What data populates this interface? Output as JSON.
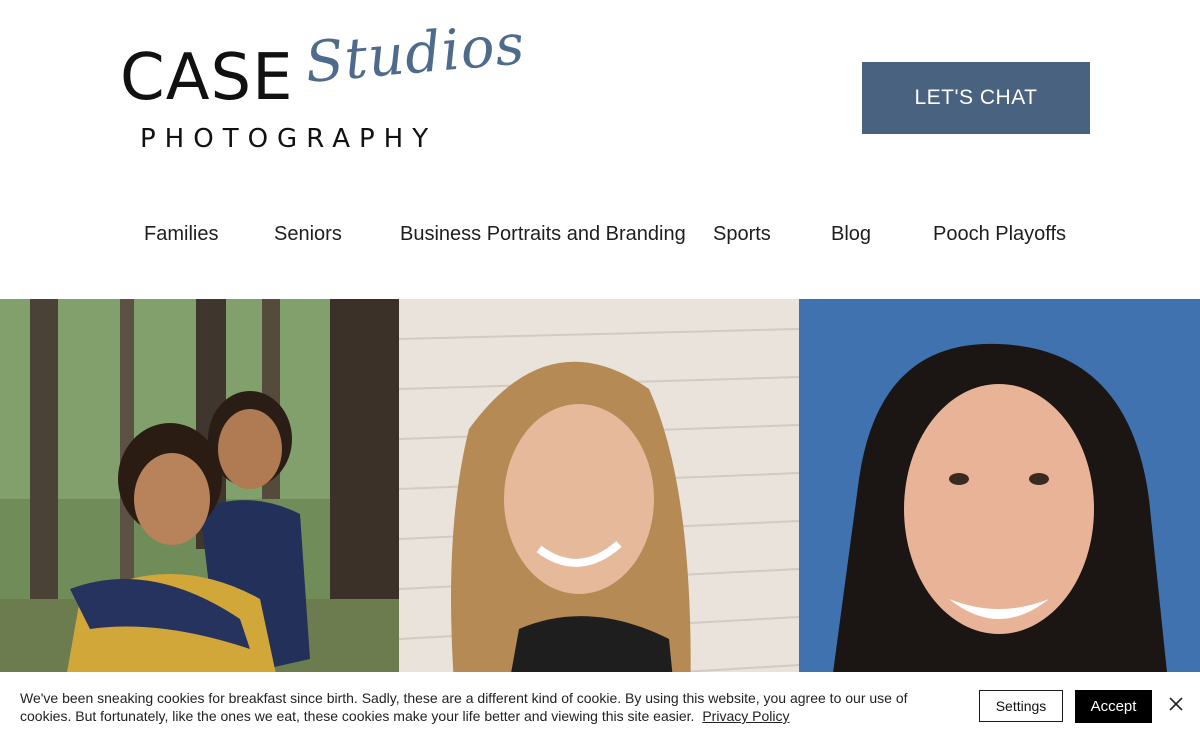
{
  "header": {
    "logo": {
      "line1": "CASE",
      "script": "Studios",
      "line2": "PHOTOGRAPHY"
    },
    "cta_label": "LET'S CHAT"
  },
  "nav": {
    "items": [
      {
        "label": "Families"
      },
      {
        "label": "Seniors"
      },
      {
        "label": "Business Portraits and Branding"
      },
      {
        "label": "Sports"
      },
      {
        "label": "Blog"
      },
      {
        "label": "Pooch Playoffs"
      }
    ]
  },
  "photos": [
    {
      "subject": "two-girls-hugging-in-forest"
    },
    {
      "subject": "smiling-teen-girl-brick-wall"
    },
    {
      "subject": "smiling-woman-blue-background"
    }
  ],
  "cookie_banner": {
    "text": "We've been sneaking cookies for breakfast since birth. Sadly, these are a different kind of cookie. By using this website, you agree to our use of cookies. But fortunately, like the ones we eat, these cookies make your life better and viewing this site easier.",
    "privacy_link": "Privacy Policy",
    "settings_label": "Settings",
    "accept_label": "Accept",
    "close_icon": "close-icon"
  },
  "colors": {
    "brand_blue": "#48627f",
    "script_blue": "#4f6b8c",
    "text_dark": "#1e1e1e"
  }
}
